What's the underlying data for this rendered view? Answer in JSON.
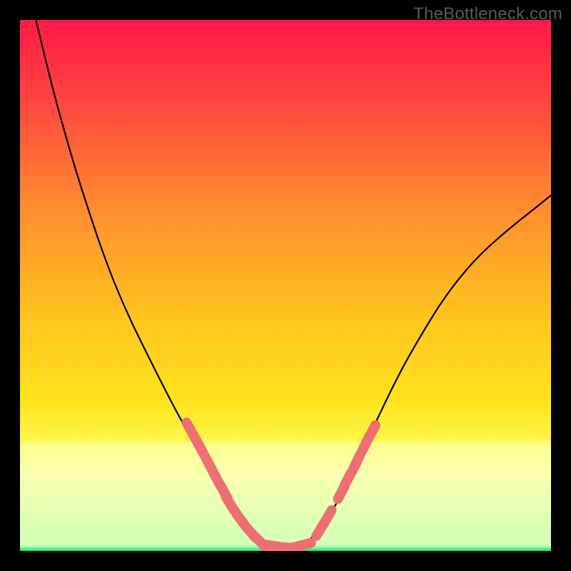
{
  "watermark": "TheBottleneck.com",
  "chart_data": {
    "type": "line",
    "title": "",
    "xlabel": "",
    "ylabel": "",
    "xlim": [
      0,
      100
    ],
    "ylim": [
      0,
      100
    ],
    "grid": false,
    "legend": false,
    "background": {
      "top_color": "#ff1a46",
      "mid_color": "#ffd31a",
      "green_band_start_color": "#feff8e",
      "green_band_end_color": "#00e66a",
      "green_band_y_start": 76,
      "green_band_y_end": 100
    },
    "series": [
      {
        "name": "bottleneck-curve",
        "type": "curve",
        "stroke": "#000000",
        "points": [
          {
            "x": 3,
            "y": 0
          },
          {
            "x": 7,
            "y": 16
          },
          {
            "x": 12,
            "y": 33
          },
          {
            "x": 18,
            "y": 50
          },
          {
            "x": 25,
            "y": 65
          },
          {
            "x": 33,
            "y": 80
          },
          {
            "x": 41,
            "y": 92
          },
          {
            "x": 47,
            "y": 99
          },
          {
            "x": 53,
            "y": 99
          },
          {
            "x": 59,
            "y": 92
          },
          {
            "x": 64,
            "y": 82
          },
          {
            "x": 74,
            "y": 62
          },
          {
            "x": 85,
            "y": 46
          },
          {
            "x": 100,
            "y": 33
          }
        ]
      },
      {
        "name": "lozenge-markers-left",
        "type": "markers",
        "color": "#ed6f71",
        "points": [
          {
            "x": 32.0,
            "y": 77.0
          },
          {
            "x": 33.4,
            "y": 79.5
          },
          {
            "x": 34.2,
            "y": 81.0
          },
          {
            "x": 35.8,
            "y": 84.0
          },
          {
            "x": 37.1,
            "y": 86.5
          },
          {
            "x": 38.5,
            "y": 89.0
          },
          {
            "x": 39.5,
            "y": 91.0
          },
          {
            "x": 41.5,
            "y": 94.0
          },
          {
            "x": 43.5,
            "y": 96.5
          },
          {
            "x": 45.5,
            "y": 98.5
          }
        ]
      },
      {
        "name": "lozenge-markers-bottom",
        "type": "markers",
        "color": "#ed6f71",
        "points": [
          {
            "x": 47.5,
            "y": 99.0
          },
          {
            "x": 49.5,
            "y": 99.3
          },
          {
            "x": 51.5,
            "y": 99.3
          },
          {
            "x": 53.5,
            "y": 98.8
          }
        ]
      },
      {
        "name": "lozenge-markers-right",
        "type": "markers",
        "color": "#ed6f71",
        "points": [
          {
            "x": 56.5,
            "y": 96.0
          },
          {
            "x": 58.0,
            "y": 93.5
          },
          {
            "x": 60.5,
            "y": 89.0
          },
          {
            "x": 61.7,
            "y": 86.5
          },
          {
            "x": 62.8,
            "y": 84.5
          },
          {
            "x": 63.5,
            "y": 83.0
          },
          {
            "x": 65.0,
            "y": 80.0
          },
          {
            "x": 66.3,
            "y": 77.5
          }
        ]
      }
    ]
  }
}
